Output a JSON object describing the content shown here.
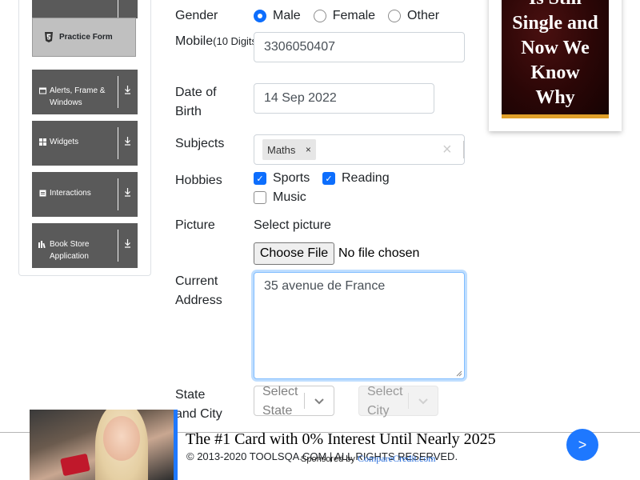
{
  "sidebar": {
    "active_item": {
      "label": "Practice Form",
      "icon": "html5-icon"
    },
    "groups": [
      {
        "label": "Alerts, Frame & Windows",
        "icon": "window-icon"
      },
      {
        "label": "Widgets",
        "icon": "widgets-grid-icon"
      },
      {
        "label": "Interactions",
        "icon": "interactions-icon"
      },
      {
        "label": "Book Store Application",
        "icon": "book-store-icon"
      }
    ]
  },
  "form": {
    "gender": {
      "label": "Gender",
      "options": [
        "Male",
        "Female",
        "Other"
      ],
      "selected": "Male"
    },
    "mobile": {
      "label": "Mobile",
      "hint": "(10 Digits)",
      "value": "3306050407"
    },
    "dob": {
      "label_line1": "Date of",
      "label_line2": "Birth",
      "value": "14 Sep 2022"
    },
    "subjects": {
      "label": "Subjects",
      "chips": [
        "Maths"
      ],
      "clear": "×",
      "chip_remove": "×"
    },
    "hobbies": {
      "label": "Hobbies",
      "options": [
        {
          "label": "Sports",
          "checked": true
        },
        {
          "label": "Reading",
          "checked": true
        },
        {
          "label": "Music",
          "checked": false
        }
      ]
    },
    "picture": {
      "label": "Picture",
      "select_label": "Select picture",
      "button": "Choose File",
      "status": "No file chosen"
    },
    "address": {
      "label_line1": "Current",
      "label_line2": "Address",
      "value": "35 avenue de France"
    },
    "state_city": {
      "label_line1": "State",
      "label_line2": "and City",
      "state_placeholder": "Select\nState",
      "state_line1": "Select",
      "state_line2": "State",
      "city_line1": "Select",
      "city_line2": "City"
    }
  },
  "right_ad": {
    "lines": [
      "Is Still",
      "Single and",
      "Now We",
      "Know",
      "Why"
    ]
  },
  "footer": {
    "copyright": "© 2013-2020 TOOLSQA.COM | ALL RIGHTS RESERVED."
  },
  "bottom_ad": {
    "headline": "The #1 Card with 0% Interest Until Nearly 2025",
    "sponsored_prefix": "Sponsored by",
    "sponsor": "CompareCredit.com",
    "next": ">"
  },
  "colors": {
    "accent": "#0d6efd",
    "sidebar_group": "#5a5a5a",
    "ad_blue": "#1e78ff"
  }
}
